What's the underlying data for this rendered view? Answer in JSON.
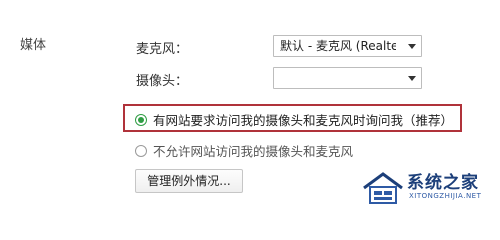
{
  "media": {
    "section_title": "媒体",
    "microphone": {
      "label": "麦克风：",
      "selected": "默认 - 麦克风 (Realtek"
    },
    "camera": {
      "label": "摄像头：",
      "selected": ""
    },
    "options": [
      {
        "label": "有网站要求访问我的摄像头和麦克风时询问我（推荐）",
        "checked": true
      },
      {
        "label": "不允许网站访问我的摄像头和麦克风",
        "checked": false
      }
    ],
    "manage_button": "管理例外情况..."
  },
  "watermark": {
    "title": "系统之家",
    "subtitle": "XITONGZHIJIA.NET"
  },
  "colors": {
    "highlight_border": "#b0323a",
    "radio_checked": "#2f9d44",
    "watermark": "#1c3f7a"
  }
}
